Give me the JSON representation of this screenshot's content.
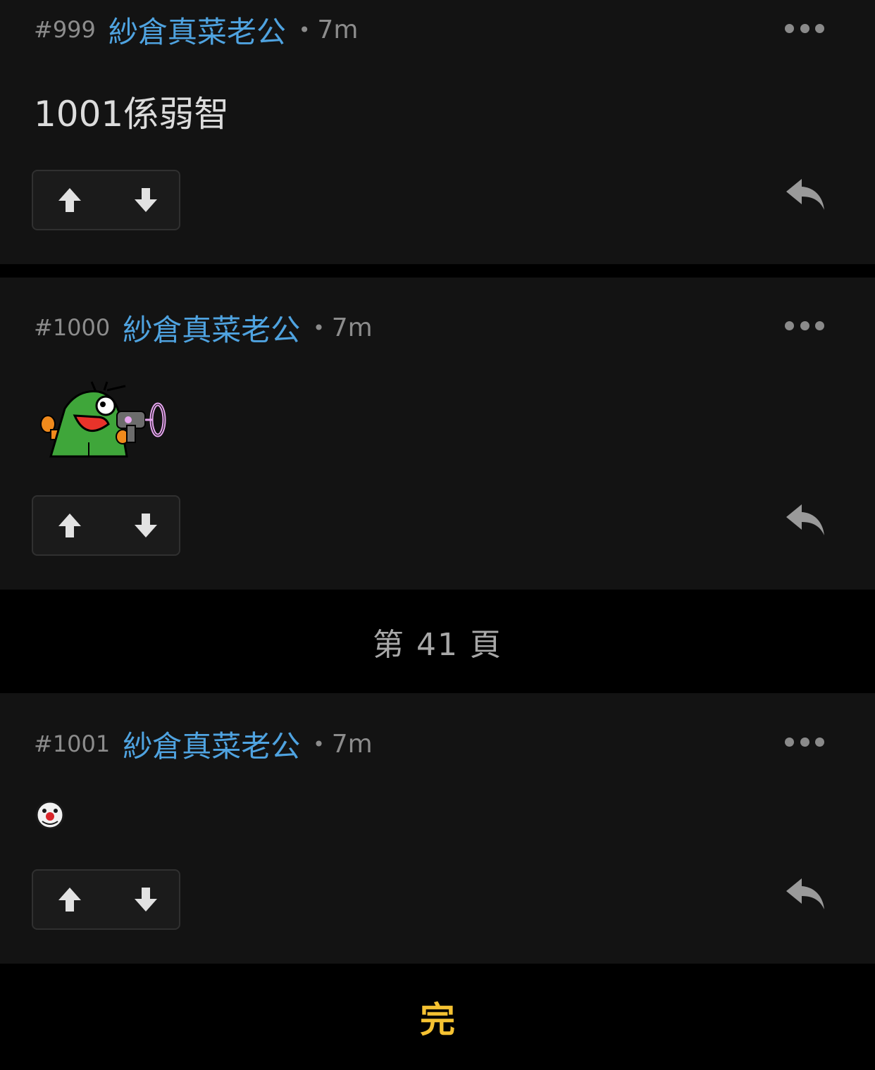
{
  "posts": [
    {
      "number": "#999",
      "username": "紗倉真菜老公",
      "separator": "•",
      "time": "7m",
      "body_text": "1001係弱智"
    },
    {
      "number": "#1000",
      "username": "紗倉真菜老公",
      "separator": "•",
      "time": "7m",
      "sticker": "green-creature-sticker"
    },
    {
      "number": "#1001",
      "username": "紗倉真菜老公",
      "separator": "•",
      "time": "7m",
      "sticker": "clown-face-emoji"
    }
  ],
  "page_divider": "第 41 頁",
  "end_label": "完",
  "icons": {
    "more": "more-dots-icon",
    "upvote": "arrow-up-icon",
    "downvote": "arrow-down-icon",
    "reply": "reply-icon"
  },
  "colors": {
    "username": "#4fa3e0",
    "end_label": "#f5c232",
    "post_bg": "#131313",
    "page_bg": "#000000"
  }
}
